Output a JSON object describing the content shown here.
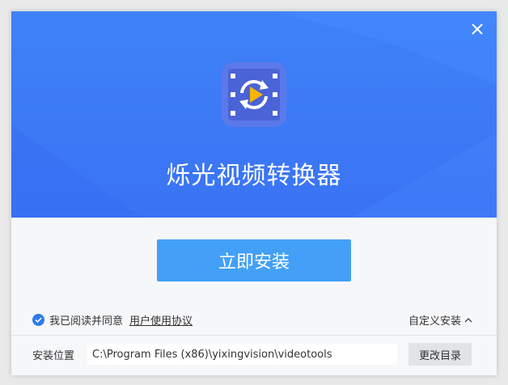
{
  "window": {
    "title": "烁光视频转换器"
  },
  "header": {
    "app_title": "烁光视频转换器",
    "close_icon": "close-icon",
    "logo_icon": "video-convert-icon"
  },
  "main": {
    "install_label": "立即安装",
    "agree_text": "我已阅读并同意",
    "agreement_link": "用户使用协议",
    "agreed": true,
    "custom_install_label": "自定义安装"
  },
  "install_path": {
    "label": "安装位置",
    "value": "C:\\Program Files (x86)\\yixingvision\\videotools",
    "change_label": "更改目录"
  },
  "colors": {
    "hero_blue": "#3f82f7",
    "button_blue": "#43a0f6",
    "check_blue": "#2f7be8"
  }
}
